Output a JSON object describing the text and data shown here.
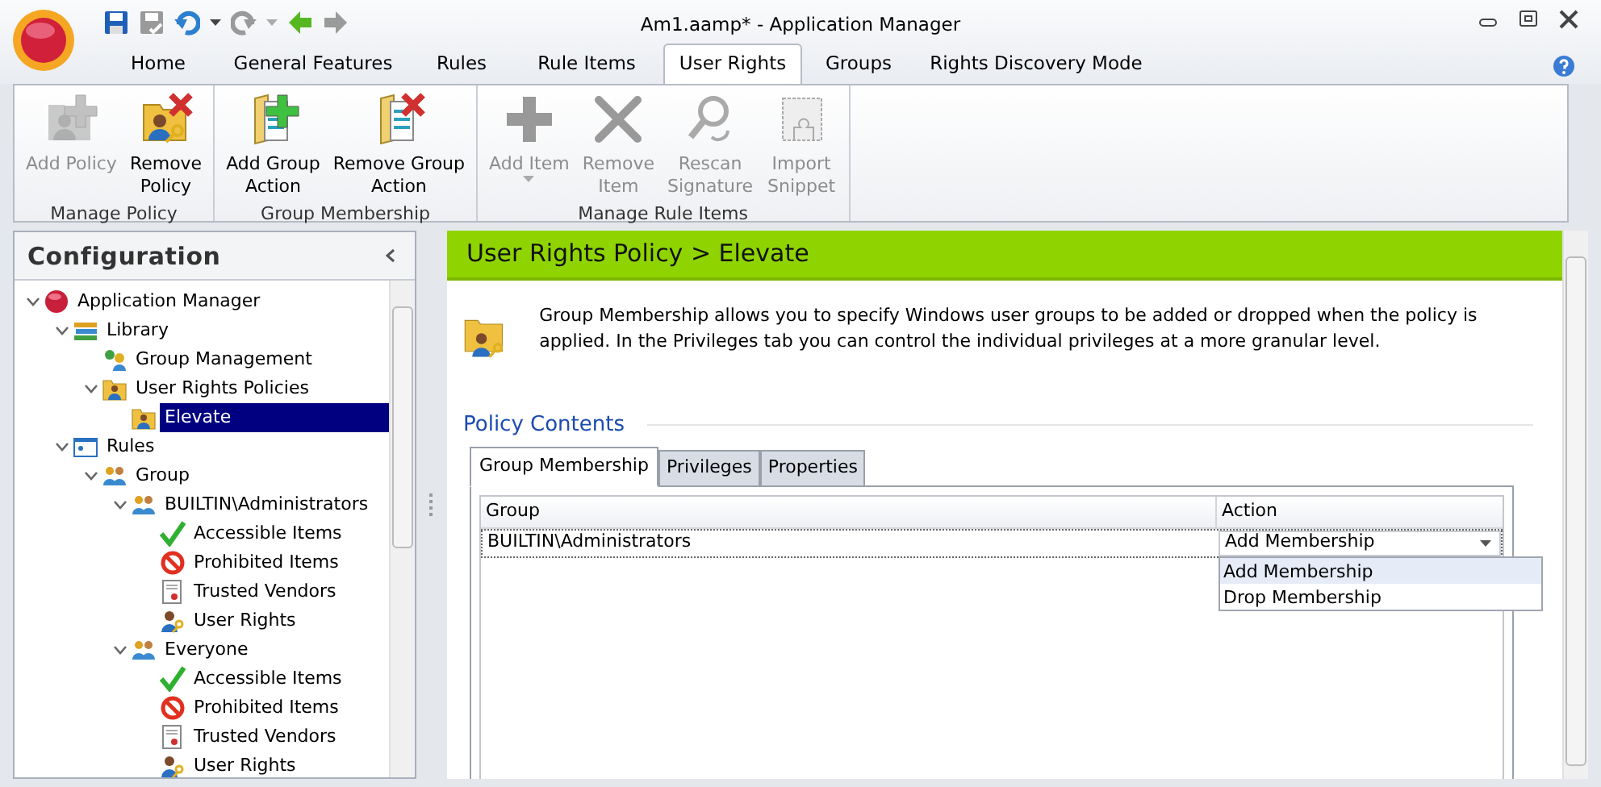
{
  "window": {
    "title": "Am1.aamp* - Application Manager"
  },
  "quick_access": [
    {
      "kind": "save",
      "disabled": false
    },
    {
      "kind": "save-all",
      "disabled": true
    },
    {
      "kind": "undo",
      "disabled": false,
      "dropdown": true
    },
    {
      "kind": "redo",
      "disabled": true,
      "dropdown": true
    },
    {
      "kind": "back",
      "disabled": false
    },
    {
      "kind": "forward",
      "disabled": true
    }
  ],
  "ribbon_tabs": [
    {
      "label": "Home",
      "selected": false
    },
    {
      "label": "General Features",
      "selected": false
    },
    {
      "label": "Rules",
      "selected": false
    },
    {
      "label": "Rule Items",
      "selected": false
    },
    {
      "label": "User Rights",
      "selected": true
    },
    {
      "label": "Groups",
      "selected": false
    },
    {
      "label": "Rights Discovery Mode",
      "selected": false
    }
  ],
  "ribbon_groups": [
    {
      "label": "Manage Policy",
      "buttons": [
        {
          "label": "Add Policy",
          "kind": "add-policy",
          "disabled": true
        },
        {
          "label": "Remove\nPolicy",
          "kind": "remove-policy",
          "disabled": false
        }
      ]
    },
    {
      "label": "Group Membership",
      "buttons": [
        {
          "label": "Add Group\nAction",
          "kind": "add-group",
          "disabled": false
        },
        {
          "label": "Remove Group\nAction",
          "kind": "remove-group",
          "disabled": false
        }
      ]
    },
    {
      "label": "Manage Rule Items",
      "buttons": [
        {
          "label": "Add Item",
          "kind": "add-item",
          "disabled": true,
          "dropdown": true
        },
        {
          "label": "Remove\nItem",
          "kind": "remove-item",
          "disabled": true
        },
        {
          "label": "Rescan\nSignature",
          "kind": "rescan",
          "disabled": true
        },
        {
          "label": "Import\nSnippet",
          "kind": "import",
          "disabled": true
        }
      ]
    }
  ],
  "sidebar": {
    "title": "Configuration",
    "tree": [
      {
        "label": "Application Manager",
        "kind": "app",
        "expanded": true,
        "selected": false,
        "children": [
          {
            "label": "Library",
            "kind": "library",
            "expanded": true,
            "selected": false,
            "children": [
              {
                "label": "Group Management",
                "kind": "group-mgmt",
                "selected": false
              },
              {
                "label": "User Rights Policies",
                "kind": "policy-folder",
                "expanded": true,
                "selected": false,
                "children": [
                  {
                    "label": "Elevate",
                    "kind": "policy-folder",
                    "selected": true
                  }
                ]
              }
            ]
          },
          {
            "label": "Rules",
            "kind": "rules",
            "expanded": true,
            "selected": false,
            "children": [
              {
                "label": "Group",
                "kind": "users",
                "expanded": true,
                "selected": false,
                "children": [
                  {
                    "label": "BUILTIN\\Administrators",
                    "kind": "users",
                    "expanded": true,
                    "selected": false,
                    "children": [
                      {
                        "label": "Accessible Items",
                        "kind": "check",
                        "selected": false
                      },
                      {
                        "label": "Prohibited Items",
                        "kind": "prohibited",
                        "selected": false
                      },
                      {
                        "label": "Trusted Vendors",
                        "kind": "vendor",
                        "selected": false
                      },
                      {
                        "label": "User Rights",
                        "kind": "user-key",
                        "selected": false
                      }
                    ]
                  },
                  {
                    "label": "Everyone",
                    "kind": "users",
                    "expanded": true,
                    "selected": false,
                    "children": [
                      {
                        "label": "Accessible Items",
                        "kind": "check",
                        "selected": false
                      },
                      {
                        "label": "Prohibited Items",
                        "kind": "prohibited",
                        "selected": false
                      },
                      {
                        "label": "Trusted Vendors",
                        "kind": "vendor",
                        "selected": false
                      },
                      {
                        "label": "User Rights",
                        "kind": "user-key",
                        "selected": false
                      }
                    ]
                  }
                ]
              }
            ]
          }
        ]
      }
    ]
  },
  "content": {
    "header": "User Rights Policy > Elevate",
    "description": "Group Membership allows you to specify Windows user groups to be added or dropped when the policy is applied.  In the Privileges tab you can control the individual privileges at a more granular level.",
    "section_title": "Policy Contents",
    "tabs": [
      {
        "label": "Group Membership",
        "selected": true
      },
      {
        "label": "Privileges",
        "selected": false
      },
      {
        "label": "Properties",
        "selected": false
      }
    ],
    "table": {
      "columns": [
        "Group",
        "Action"
      ],
      "rows": [
        {
          "group": "BUILTIN\\Administrators",
          "action": "Add Membership"
        }
      ]
    },
    "action_dropdown": {
      "options": [
        {
          "label": "Add Membership",
          "selected": true
        },
        {
          "label": "Drop Membership",
          "selected": false
        }
      ]
    }
  }
}
